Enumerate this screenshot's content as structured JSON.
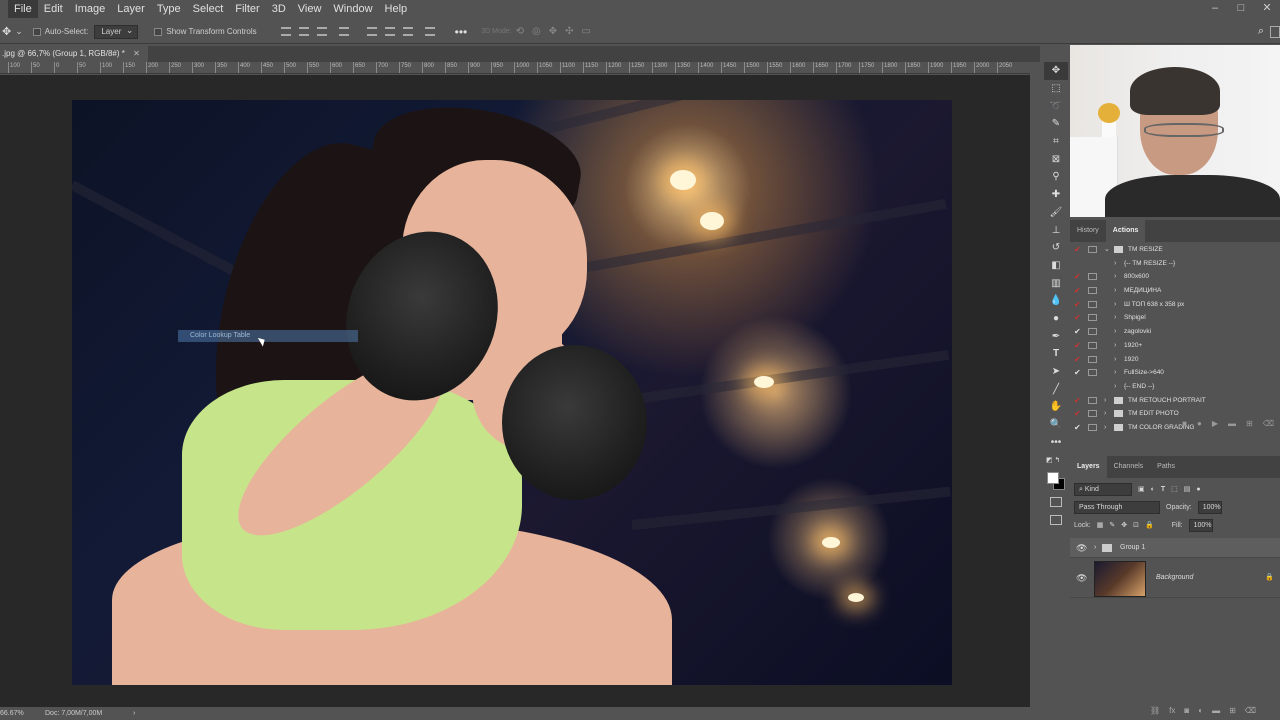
{
  "menu": [
    "File",
    "Edit",
    "Image",
    "Layer",
    "Type",
    "Select",
    "Filter",
    "3D",
    "View",
    "Window",
    "Help"
  ],
  "window_controls": [
    "–",
    "□",
    "✕"
  ],
  "options": {
    "auto_select_label": "Auto-Select:",
    "auto_select_value": "Layer",
    "show_transform_label": "Show Transform Controls",
    "mode_3d_label": "3D Mode:"
  },
  "document": {
    "tab_title": ".jpg @ 66,7% (Group 1, RGB/8#) *"
  },
  "ruler": [
    "100",
    "50",
    "0",
    "50",
    "100",
    "150",
    "200",
    "250",
    "300",
    "350",
    "400",
    "450",
    "500",
    "550",
    "600",
    "650",
    "700",
    "750",
    "800",
    "850",
    "900",
    "950",
    "1000",
    "1050",
    "1100",
    "1150",
    "1200",
    "1250",
    "1300",
    "1350",
    "1400",
    "1450",
    "1500",
    "1550",
    "1600",
    "1650",
    "1700",
    "1750",
    "1800",
    "1850",
    "1900",
    "1950",
    "2000",
    "2050"
  ],
  "canvas": {
    "tooltip_text": "Color Lookup Table"
  },
  "status": {
    "zoom": "66.67%",
    "doc": "Doc: 7,00M/7,00M"
  },
  "history_panel": {
    "tabs": [
      "History",
      "Actions"
    ],
    "active_tab": "Actions",
    "actions": [
      {
        "check": "red",
        "indent": 0,
        "expand": "v",
        "folder": true,
        "label": "TM RESIZE"
      },
      {
        "check": "none",
        "indent": 1,
        "expand": ">",
        "folder": false,
        "label": "{-- TM RESIZE --}"
      },
      {
        "check": "red",
        "indent": 1,
        "expand": ">",
        "folder": false,
        "label": "800x600"
      },
      {
        "check": "red",
        "indent": 1,
        "expand": ">",
        "folder": false,
        "label": "МЕДИЦИНА"
      },
      {
        "check": "red",
        "indent": 1,
        "expand": ">",
        "folder": false,
        "label": "Ш ТОП 638 x 358 px"
      },
      {
        "check": "red",
        "indent": 1,
        "expand": ">",
        "folder": false,
        "label": "Shpigel"
      },
      {
        "check": "white",
        "indent": 1,
        "expand": ">",
        "folder": false,
        "label": "zagolovki"
      },
      {
        "check": "red",
        "indent": 1,
        "expand": ">",
        "folder": false,
        "label": "1920+"
      },
      {
        "check": "red",
        "indent": 1,
        "expand": ">",
        "folder": false,
        "label": "1920"
      },
      {
        "check": "white",
        "indent": 1,
        "expand": ">",
        "folder": false,
        "label": "FullSize->640"
      },
      {
        "check": "none",
        "indent": 1,
        "expand": ">",
        "folder": false,
        "label": "{-- END --}"
      },
      {
        "check": "red",
        "indent": 0,
        "expand": ">",
        "folder": true,
        "label": "TM RETOUCH PORTRAIT"
      },
      {
        "check": "red",
        "indent": 0,
        "expand": ">",
        "folder": true,
        "label": "TM EDIT PHOTO"
      },
      {
        "check": "white",
        "indent": 0,
        "expand": ">",
        "folder": true,
        "label": "TM COLOR GRADING"
      }
    ]
  },
  "layers_panel": {
    "tabs": [
      "Layers",
      "Channels",
      "Paths"
    ],
    "active_tab": "Layers",
    "filter_kind": "Kind",
    "blend_mode": "Pass Through",
    "opacity_label": "Opacity:",
    "opacity_value": "100%",
    "lock_label": "Lock:",
    "fill_label": "Fill:",
    "fill_value": "100%",
    "layers": [
      {
        "name": "Group 1",
        "type": "group"
      },
      {
        "name": "Background",
        "type": "image"
      }
    ]
  },
  "colors": {
    "accent": "#5a85c0",
    "panel_bg": "#535353",
    "canvas_bg": "#282828"
  }
}
